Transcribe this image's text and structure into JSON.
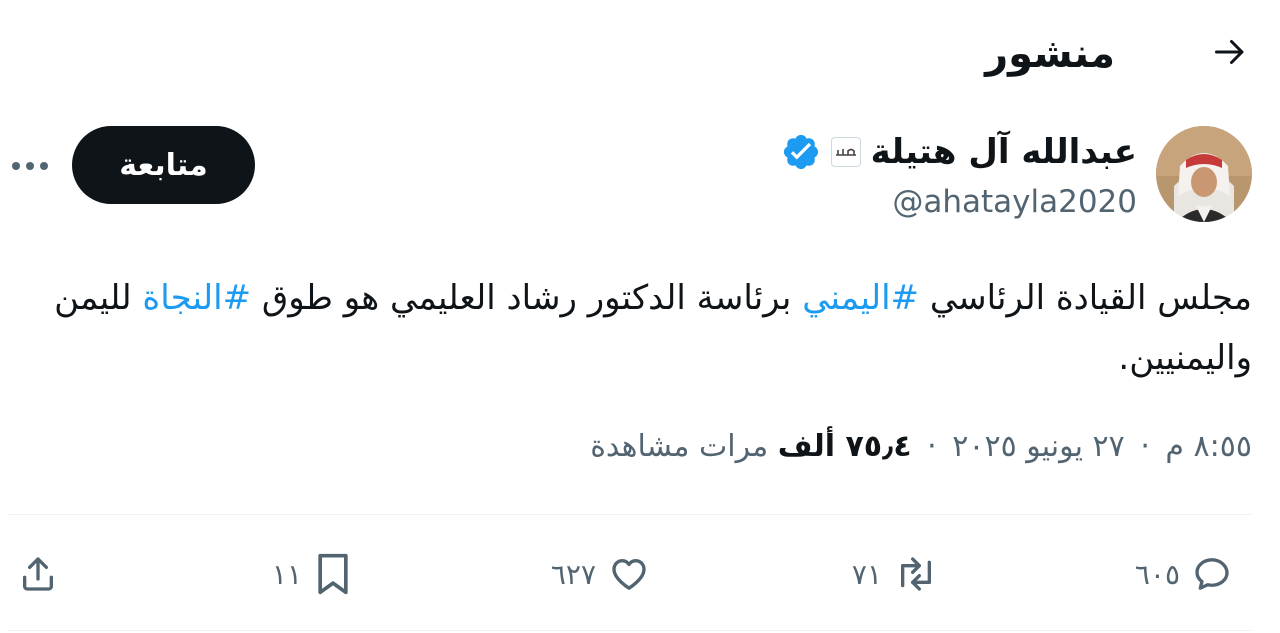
{
  "header": {
    "title": "منشور",
    "back_icon": "arrow-right-icon"
  },
  "author": {
    "name": "عبدالله آل هتيلة",
    "handle": "@ahatayla2020",
    "affiliate_badge_text": "عكاظ",
    "verified_icon": "verified-badge-icon",
    "avatar_icon": "avatar"
  },
  "follow_button": {
    "label": "متابعة"
  },
  "more_icon": "more-options-icon",
  "tweet": {
    "text_part1": "مجلس القيادة الرئاسي ",
    "hashtag1": "#اليمني",
    "text_part2": " برئاسة الدكتور رشاد العليمي هو طوق ",
    "hashtag2": "#النجاة",
    "text_part3": " لليمن واليمنيين."
  },
  "meta": {
    "time": "٨:٥٥ م",
    "date": "٢٧ يونيو ٢٠٢٥",
    "views_count": "٧٥٫٤ ألف",
    "views_label": "مرات مشاهدة",
    "separator": "·"
  },
  "actions": {
    "replies": "٦٠٥",
    "retweets": "٧١",
    "likes": "٦٢٧",
    "bookmarks": "١١"
  },
  "colors": {
    "accent": "#1d9bf0",
    "text": "#0f1419",
    "secondary": "#536471",
    "follow_bg": "#0f1419"
  }
}
